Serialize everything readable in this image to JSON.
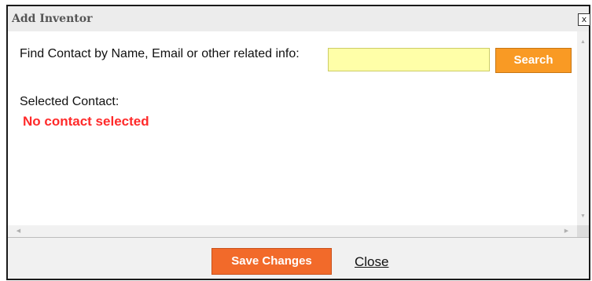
{
  "dialog": {
    "title": "Add Inventor",
    "close_icon_glyph": "x"
  },
  "search": {
    "label": "Find Contact by Name, Email or other related info:",
    "value": "",
    "placeholder": "",
    "button_label": "Search"
  },
  "selected": {
    "label": "Selected Contact:",
    "value": "No contact selected"
  },
  "footer": {
    "save_label": "Save Changes",
    "close_label": "Close"
  },
  "icons": {
    "close": "close-icon",
    "scroll_up": "arrow-up-icon",
    "scroll_down": "arrow-down-icon",
    "scroll_left": "arrow-left-icon",
    "scroll_right": "arrow-right-icon"
  },
  "colors": {
    "search_button": "#f99a24",
    "save_button": "#f26a2a",
    "input_bg": "#ffffa8",
    "warning_text": "#ff2a2a"
  }
}
